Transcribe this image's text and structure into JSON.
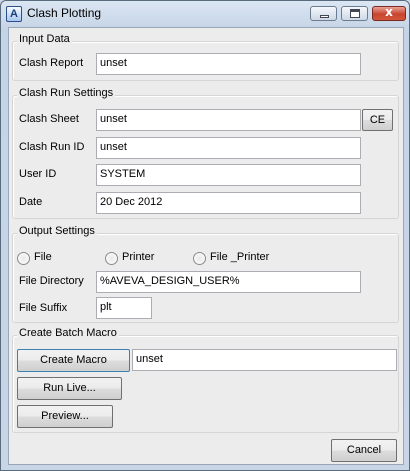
{
  "window": {
    "title": "Clash Plotting",
    "app_icon_letter": "A",
    "close_glyph": "x"
  },
  "input_data": {
    "legend": "Input Data",
    "clash_report_label": "Clash Report",
    "clash_report_value": "unset"
  },
  "clash_run_settings": {
    "legend": "Clash Run Settings",
    "clash_sheet_label": "Clash Sheet",
    "clash_sheet_value": "unset",
    "ce_button": "CE",
    "clash_run_id_label": "Clash Run ID",
    "clash_run_id_value": "unset",
    "user_id_label": "User ID",
    "user_id_value": "SYSTEM",
    "date_label": "Date",
    "date_value": "20 Dec 2012"
  },
  "output_settings": {
    "legend": "Output Settings",
    "radio_file": "File",
    "radio_printer": "Printer",
    "radio_file_printer": "File _Printer",
    "file_directory_label": "File Directory",
    "file_directory_value": "%AVEVA_DESIGN_USER%",
    "file_suffix_label": "File Suffix",
    "file_suffix_value": "plt"
  },
  "create_batch_macro": {
    "legend": "Create Batch Macro",
    "create_macro_button": "Create Macro",
    "macro_value": "unset",
    "run_live_button": "Run Live...",
    "preview_button": "Preview..."
  },
  "footer": {
    "cancel_button": "Cancel"
  }
}
